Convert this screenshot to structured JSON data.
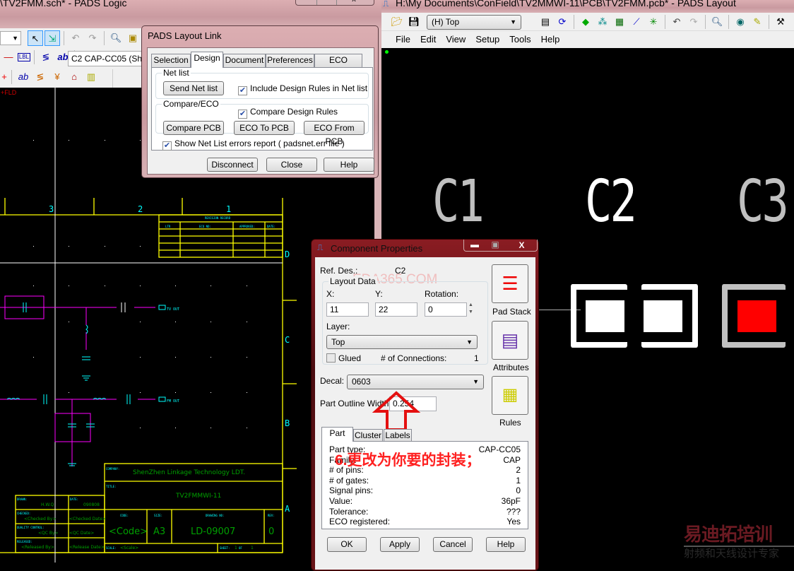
{
  "logic_window": {
    "title": "\\TV2FMM.sch* - PADS Logic",
    "part_combo": "C2 CAP-CC05 (She",
    "toolbar_icons": [
      "select-filter-icon",
      "select-mode-icon",
      "undo-icon",
      "redo-icon",
      "zoom-icon",
      "properties-icon",
      "eraser-icon"
    ],
    "schematic": {
      "column_numbers": [
        "3",
        "2",
        "1"
      ],
      "row_letters": [
        "D",
        "C",
        "B",
        "A"
      ],
      "revision_record": {
        "title": "REVISION RECORD",
        "headers": [
          "LTR",
          "ECO NO:",
          "APPROVED:",
          "DATE:"
        ]
      },
      "title_block": {
        "company_label": "COMPANY:",
        "company": "ShenZhen Linkage Technology LDT.",
        "title_label": "TITLE:",
        "title": "TV2FMMWI-11",
        "code_label": "CODE:",
        "code": "<Code>",
        "size_label": "SIZE:",
        "size": "A3",
        "drawing_no_label": "DRAWING NO:",
        "drawing_no": "LD-09007",
        "rev_label": "REV:",
        "rev": "0",
        "drawn_label": "DRAWN:",
        "drawn": "H.W.Q",
        "date_label": "DATE:",
        "drawn_date": "090808",
        "checked_label": "CHECKED:",
        "checked_by": "<Checked By>",
        "checked_date": "<Checked Date>",
        "qc_label": "QUALITY CONTROL:",
        "qc_by": "<QC By>",
        "qc_date": "<QC Date>",
        "released_label": "RELEASED:",
        "released_by": "<Released By>",
        "release_date": "<Release Date>",
        "scale_label": "SCALE:",
        "scale": "<Scale>",
        "sheet_label": "SHEET:",
        "sheet": "1",
        "of_label": "OF",
        "sheet_total": "1"
      },
      "net_labels": [
        "TV OUT",
        "FM OUT"
      ]
    }
  },
  "layout_link": {
    "title": "PADS Layout Link",
    "tabs": [
      "Selection",
      "Design",
      "Document",
      "Preferences",
      "ECO Names"
    ],
    "active_tab": "Design",
    "netlist_group": "Net list",
    "send_netlist": "Send Net list",
    "include_rules": {
      "label": "Include Design Rules in Net list",
      "checked": true
    },
    "compare_group": "Compare/ECO",
    "compare_rules": {
      "label": "Compare Design Rules",
      "checked": true
    },
    "compare_pcb": "Compare PCB",
    "eco_to_pcb": "ECO To PCB",
    "eco_from_pcb": "ECO From PCB",
    "show_errors": {
      "label": "Show Net List errors report ( padsnet.err file )",
      "checked": true
    },
    "disconnect": "Disconnect",
    "close": "Close",
    "help": "Help"
  },
  "layout_window": {
    "title": "H:\\My Documents\\ConField\\TV2MMWI-11\\PCB\\TV2FMM.pcb* - PADS Layout",
    "layer_combo": "(H) Top",
    "menu": [
      "File",
      "Edit",
      "View",
      "Setup",
      "Tools",
      "Help"
    ],
    "ref_labels": [
      "C1",
      "C2",
      "C3"
    ],
    "colors": {
      "selected": "#ffffff",
      "normal": "#c0c0c0",
      "pad_top": "#ff0000"
    }
  },
  "component_properties": {
    "title": "Component Properties",
    "ref_des_label": "Ref. Des.:",
    "ref_des": "C2",
    "watermark": "EDA365.COM",
    "layout_data_group": "Layout Data",
    "x_label": "X:",
    "x": "11",
    "y_label": "Y:",
    "y": "22",
    "rotation_label": "Rotation:",
    "rotation": "0",
    "layer_label": "Layer:",
    "layer": "Top",
    "glued": {
      "label": "Glued",
      "checked": false
    },
    "connections_label": "# of Connections:",
    "connections": "1",
    "decal_label": "Decal:",
    "decal": "0603",
    "outline_label": "Part Outline Width:",
    "outline": "0.254",
    "pad_stack": "Pad Stack",
    "attributes": "Attributes",
    "rules": "Rules",
    "tabs": [
      "Part",
      "Cluster",
      "Labels"
    ],
    "active_tab": "Part",
    "part_rows": [
      {
        "k": "Part type:",
        "v": "CAP-CC05"
      },
      {
        "k": "Family:",
        "v": "CAP"
      },
      {
        "k": "# of pins:",
        "v": "2"
      },
      {
        "k": "# of gates:",
        "v": "1"
      },
      {
        "k": "Signal pins:",
        "v": "0"
      },
      {
        "k": "Value:",
        "v": "36pF"
      },
      {
        "k": "Tolerance:",
        "v": "???"
      },
      {
        "k": "ECO registered:",
        "v": "Yes"
      }
    ],
    "ok": "OK",
    "apply": "Apply",
    "cancel": "Cancel",
    "help": "Help"
  },
  "annotation": {
    "text": "6.更改为你要的封装；",
    "color": "#ff2020"
  },
  "logo": {
    "top": "易迪拓培训",
    "bottom": "射频和天线设计专家"
  }
}
